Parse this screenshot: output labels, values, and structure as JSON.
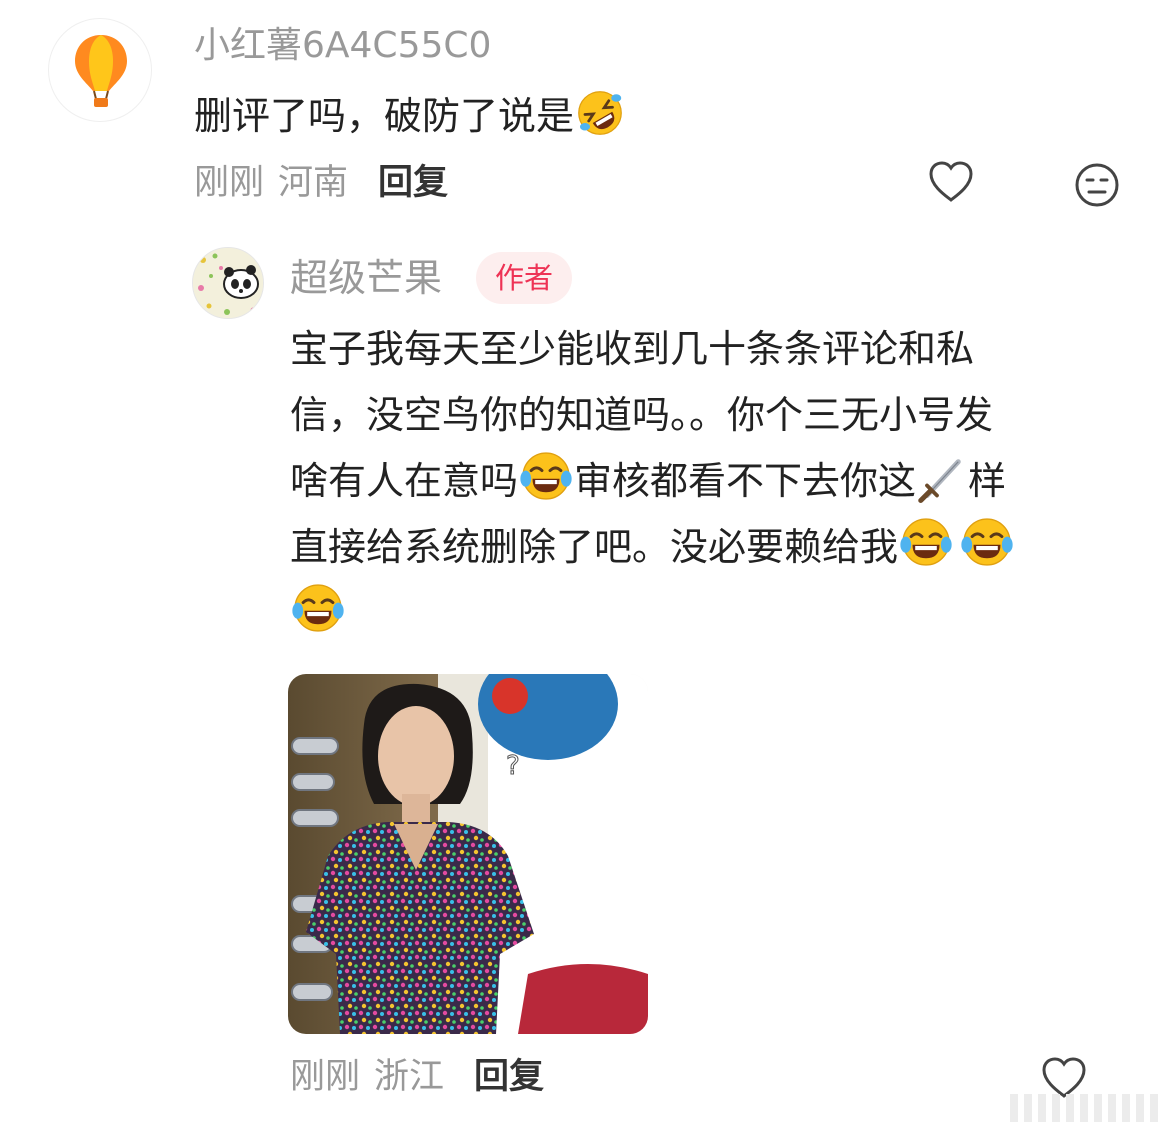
{
  "comment": {
    "username": "小红薯6A4C55C0",
    "text": "删评了吗，破防了说是",
    "time": "刚刚",
    "location": "河南",
    "reply_label": "回复"
  },
  "reply": {
    "username": "超级芒果",
    "badge": "作者",
    "lines": {
      "l1": "宝子我每天至少能收到几十条条评论和私",
      "l2": "信，没空鸟你的知道吗。。你个三无小号发",
      "l3a": "啥有人在意吗",
      "l3b": "审核都看不下去你这",
      "l3c": "样",
      "l4": "直接给系统删除了吧。没必要赖给我"
    },
    "image_mark": "?",
    "time": "刚刚",
    "location": "浙江",
    "reply_label": "回复"
  },
  "icons": {
    "avatar1": "hot-air-balloon-icon",
    "emoji_rofl": "rolling-on-floor-laughing-emoji",
    "emoji_joy": "face-with-tears-of-joy-emoji",
    "emoji_dagger": "dagger-emoji",
    "like": "heart-outline-icon",
    "dislike": "unamused-face-icon"
  },
  "colors": {
    "text": "#222222",
    "meta": "#999999",
    "badge_bg": "#fdeeee",
    "badge_text": "#ee3355"
  }
}
